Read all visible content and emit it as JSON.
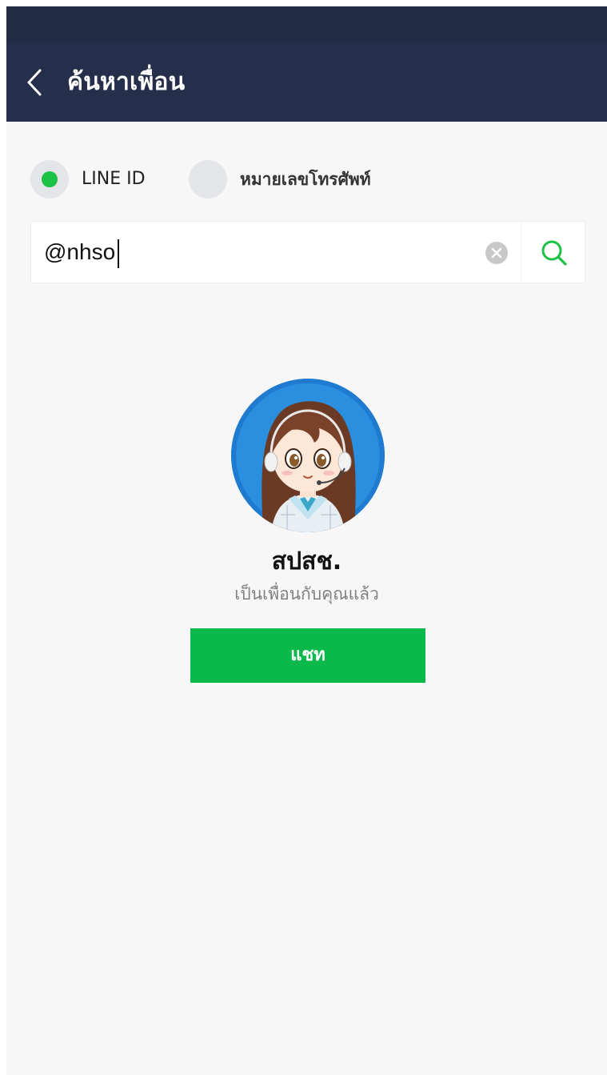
{
  "header": {
    "title": "ค้นหาเพื่อน",
    "back_icon": "chevron-left-icon"
  },
  "search_type": {
    "options": [
      {
        "label": "LINE ID",
        "selected": true
      },
      {
        "label": "หมายเลขโทรศัพท์",
        "selected": false
      }
    ]
  },
  "search": {
    "value": "@nhso",
    "clear_icon": "clear-icon",
    "search_icon": "search-icon"
  },
  "result": {
    "name": "สปสช.",
    "status": "เป็นเพื่อนกับคุณแล้ว",
    "chat_label": "แชท"
  },
  "colors": {
    "header": "#252e4b",
    "accent_green": "#0ab94a",
    "background": "#f7f7f7"
  }
}
